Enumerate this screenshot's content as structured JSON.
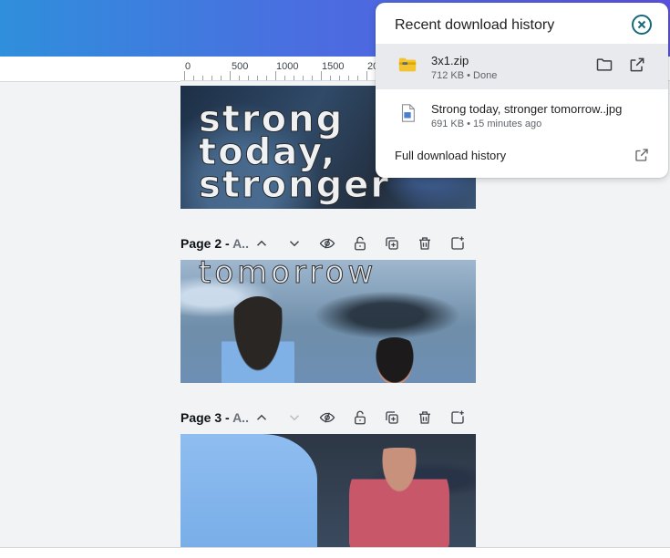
{
  "ruler": {
    "labels": [
      "0",
      "500",
      "1000",
      "1500",
      "20"
    ]
  },
  "pages": [
    {
      "words": [
        "strong",
        "today,",
        "stronger"
      ]
    },
    {
      "label_bold": "Page 2 - ",
      "label_dim": "A..",
      "word": "tomorrow"
    },
    {
      "label_bold": "Page 3 - ",
      "label_dim": "A.."
    }
  ],
  "page_bar_icons": [
    "chevron-up-icon",
    "chevron-down-icon",
    "eye-slash-icon",
    "lock-open-icon",
    "duplicate-icon",
    "trash-icon",
    "add-page-icon"
  ],
  "downloads": {
    "title": "Recent download history",
    "items": [
      {
        "name": "3x1.zip",
        "meta": "712 KB • Done",
        "icon": "folder-zip-icon"
      },
      {
        "name": "Strong today, stronger tomorrow..jpg",
        "meta": "691 KB • 15 minutes ago",
        "icon": "image-file-icon"
      }
    ],
    "full_history_label": "Full download history"
  },
  "colors": {
    "accent": "#17697a",
    "gradient_start": "#2f8fdc",
    "gradient_end": "#5b50df"
  }
}
